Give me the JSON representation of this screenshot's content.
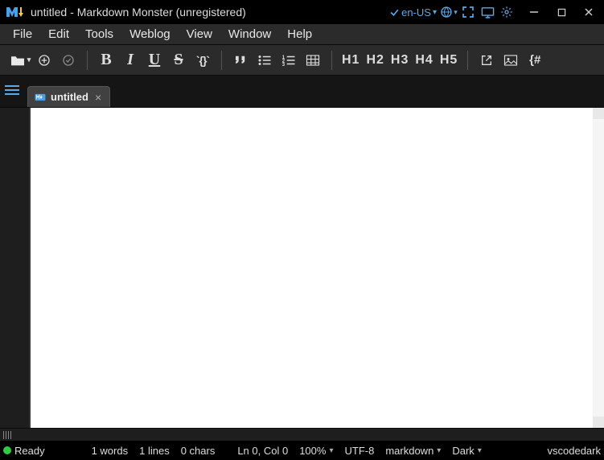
{
  "titlebar": {
    "doc_name": "untitled",
    "app_name": "  -  Markdown Monster (unregistered)",
    "language": "en-US"
  },
  "menu": {
    "file": "File",
    "edit": "Edit",
    "tools": "Tools",
    "weblog": "Weblog",
    "view": "View",
    "window": "Window",
    "help": "Help"
  },
  "toolbar": {
    "h1": "H1",
    "h2": "H2",
    "h3": "H3",
    "h4": "H4",
    "h5": "H5",
    "braces": "`{}`",
    "code_partial": "{#"
  },
  "tabs": {
    "current": "untitled"
  },
  "status": {
    "ready": "Ready",
    "words": "1 words",
    "lines": "1 lines",
    "chars": "0 chars",
    "position": "Ln 0, Col 0",
    "zoom": "100%",
    "encoding": "UTF-8",
    "syntax": "markdown",
    "theme": "Dark",
    "editor_theme": "vscodedark"
  }
}
